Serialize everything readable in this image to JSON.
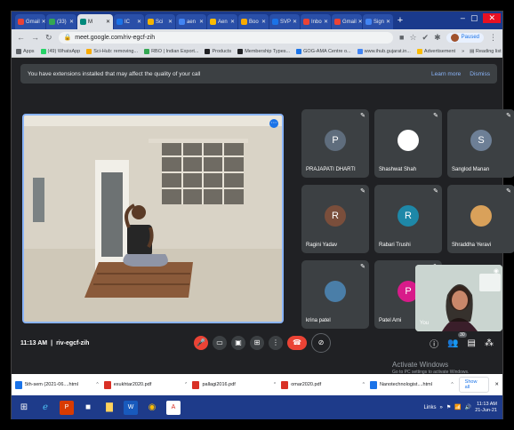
{
  "browser": {
    "tabs": [
      {
        "label": "Gmail",
        "color": "#ea4335"
      },
      {
        "label": "(33)",
        "color": "#34a853"
      },
      {
        "label": "M",
        "color": "#00897b",
        "active": true
      },
      {
        "label": "IC",
        "color": "#1a73e8"
      },
      {
        "label": "Sci",
        "color": "#f4b400"
      },
      {
        "label": "aen",
        "color": "#4285f4"
      },
      {
        "label": "Aen",
        "color": "#fbbc04"
      },
      {
        "label": "Boo",
        "color": "#f9ab00"
      },
      {
        "label": "SVP",
        "color": "#1a73e8"
      },
      {
        "label": "Inbo",
        "color": "#ea4335"
      },
      {
        "label": "Gmail",
        "color": "#ea4335"
      },
      {
        "label": "Sign",
        "color": "#4285f4"
      }
    ],
    "new_tab_label": "+",
    "url": "meet.google.com/riv-egcf-zih",
    "paused_label": "Paused",
    "bookmarks": [
      {
        "label": "Apps",
        "color": "#5f6368"
      },
      {
        "label": "(49) WhatsApp",
        "color": "#25d366"
      },
      {
        "label": "Sci-Hub: removing...",
        "color": "#f9ab00"
      },
      {
        "label": "RBO | Indian Export...",
        "color": "#34a853"
      },
      {
        "label": "Products",
        "color": "#202124"
      },
      {
        "label": "Membership Types...",
        "color": "#202124"
      },
      {
        "label": "GOG-AMA Centre o...",
        "color": "#1a73e8"
      },
      {
        "label": "www.ihub.gujarat.in...",
        "color": "#4285f4"
      },
      {
        "label": "Advertisement",
        "color": "#fbbc04"
      }
    ],
    "reading_list": "Reading list"
  },
  "banner": {
    "message": "You have extensions installed that may affect the quality of your call",
    "learn_more": "Learn more",
    "dismiss": "Dismiss"
  },
  "participants": [
    {
      "name": "PRAJAPATI DHARTI",
      "initial": "P",
      "color": "#5f6d7d"
    },
    {
      "name": "Shashwat Shah",
      "initial": "",
      "color": "#ffffff"
    },
    {
      "name": "Sanglod Manan",
      "initial": "S",
      "color": "#6d7f96"
    },
    {
      "name": "Ragini Yadav",
      "initial": "R",
      "color": "#7a4e3b"
    },
    {
      "name": "Rabari Trushi",
      "initial": "R",
      "color": "#1e88a8"
    },
    {
      "name": "Shraddha Yeravi",
      "initial": "",
      "color": "#d9a15a"
    },
    {
      "name": "krina patel",
      "initial": "",
      "color": "#4a7ea8"
    },
    {
      "name": "Patel Ami",
      "initial": "P",
      "color": "#d81b8a"
    }
  ],
  "self_label": "You",
  "meeting": {
    "time": "11:13 AM",
    "code": "riv-egcf-zih",
    "participant_count": "30"
  },
  "activate": {
    "title": "Activate Windows",
    "sub": "Go to PC settings to activate Windows."
  },
  "downloads": [
    {
      "name": "5th-sem (2021-06....html",
      "type": "html"
    },
    {
      "name": "exukhtar2020.pdf",
      "type": "pdf"
    },
    {
      "name": "pallagi2016.pdf",
      "type": "pdf"
    },
    {
      "name": "omar2020.pdf",
      "type": "pdf"
    },
    {
      "name": "Nanotechnologist....html",
      "type": "html"
    }
  ],
  "show_all": "Show all",
  "taskbar": {
    "links_label": "Links",
    "time": "11:13 AM",
    "date": "21-Jun-21"
  }
}
